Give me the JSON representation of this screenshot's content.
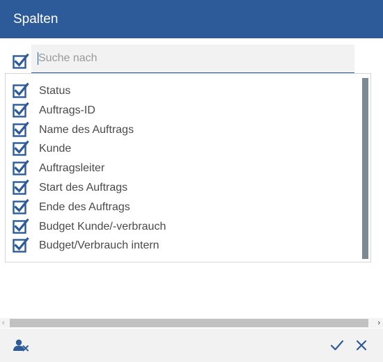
{
  "dialog": {
    "title": "Spalten"
  },
  "search": {
    "placeholder": "Suche nach",
    "value": ""
  },
  "select_all": {
    "checked": true
  },
  "columns": [
    {
      "label": "Status",
      "checked": true
    },
    {
      "label": "Auftrags-ID",
      "checked": true
    },
    {
      "label": "Name des Auftrags",
      "checked": true
    },
    {
      "label": "Kunde",
      "checked": true
    },
    {
      "label": "Auftragsleiter",
      "checked": true
    },
    {
      "label": "Start des Auftrags",
      "checked": true
    },
    {
      "label": "Ende des Auftrags",
      "checked": true
    },
    {
      "label": "Budget Kunde/-verbrauch",
      "checked": true
    },
    {
      "label": "Budget/Verbrauch intern",
      "checked": true
    }
  ],
  "horizontal_scroll": {
    "left_arrow": "‹",
    "right_arrow": "›"
  },
  "footer": {
    "reset_icon": "user-remove-icon",
    "confirm_icon": "checkmark-icon",
    "cancel_icon": "close-icon"
  },
  "colors": {
    "header_bg": "#2d5b9a",
    "checkbox": "#2d5b9a",
    "scrollbar_thumb": "#7d8a93"
  }
}
